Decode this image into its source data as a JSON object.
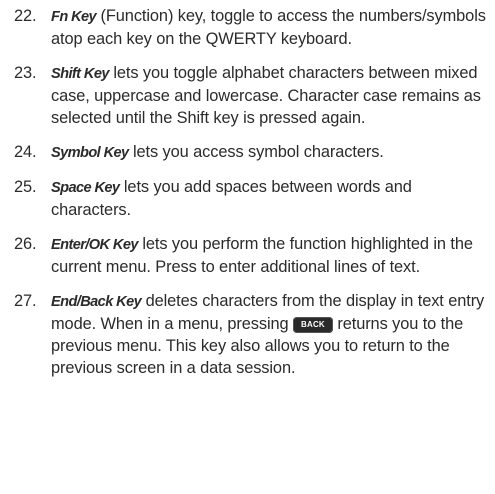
{
  "items": [
    {
      "number": "22.",
      "term": "Fn Key",
      "text": " (Function) key, toggle to access the numbers/symbols atop each key on the QWERTY keyboard."
    },
    {
      "number": "23.",
      "term": "Shift Key",
      "text": " lets you toggle alphabet characters between mixed case, uppercase and lowercase. Character case remains as selected until the Shift key is pressed again."
    },
    {
      "number": "24.",
      "term": "Symbol Key",
      "text": " lets you access symbol characters."
    },
    {
      "number": "25.",
      "term": "Space Key",
      "text": " lets you add spaces between words and characters."
    },
    {
      "number": "26.",
      "term": "Enter/OK Key",
      "text": " lets you perform the function highlighted in the current menu. Press to enter additional lines of text."
    },
    {
      "number": "27.",
      "term": "End/Back Key",
      "text_before": " deletes characters from the display in text entry mode. When in a menu, pressing ",
      "key_label": "BACK",
      "text_after": " returns you to the previous menu. This key also allows you to return to the previous screen in a data session."
    }
  ]
}
